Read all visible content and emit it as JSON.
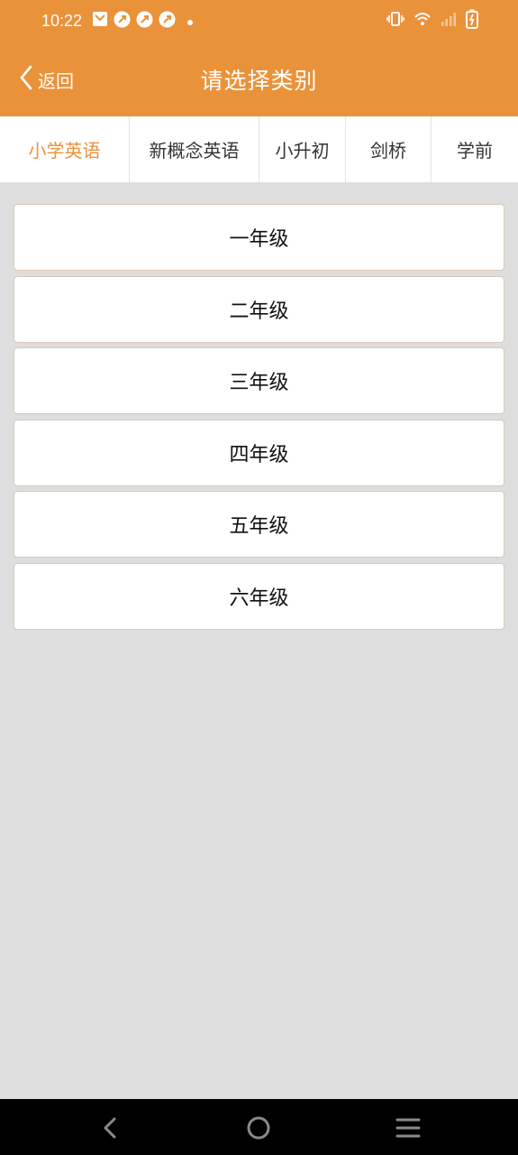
{
  "status_bar": {
    "time": "10:22",
    "left_icons": [
      "mail-icon",
      "notification-icon",
      "notification-icon",
      "notification-icon",
      "dot-icon"
    ],
    "right_icons": [
      "vibrate-icon",
      "wifi-icon",
      "signal-icon",
      "battery-icon"
    ]
  },
  "header": {
    "back_label": "返回",
    "title": "请选择类别",
    "bg_color": "#ea923a"
  },
  "tabs": [
    {
      "label": "小学英语",
      "active": true
    },
    {
      "label": "新概念英语",
      "active": false
    },
    {
      "label": "小升初",
      "active": false
    },
    {
      "label": "剑桥",
      "active": false
    },
    {
      "label": "学前",
      "active": false
    }
  ],
  "grades": [
    {
      "label": "一年级"
    },
    {
      "label": "二年级"
    },
    {
      "label": "三年级"
    },
    {
      "label": "四年级"
    },
    {
      "label": "五年级"
    },
    {
      "label": "六年级"
    }
  ],
  "nav_bar": {
    "buttons": [
      "back-icon",
      "home-icon",
      "menu-icon"
    ]
  }
}
